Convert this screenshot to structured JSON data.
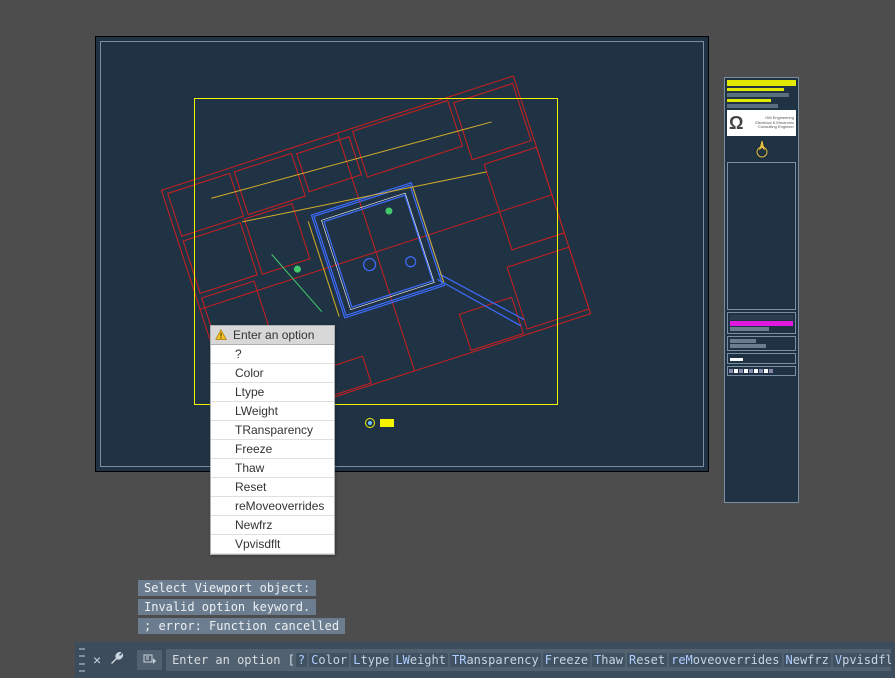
{
  "drawing": {
    "titleblock": {
      "logo_text": "Ω",
      "company_lines": [
        "OM Engineering",
        "Electrical & Electronic",
        "Consulting Engineer"
      ]
    }
  },
  "popup": {
    "header": "Enter an option",
    "items": [
      "?",
      "Color",
      "Ltype",
      "LWeight",
      "TRansparency",
      "Freeze",
      "Thaw",
      "Reset",
      "reMoveoverrides",
      "Newfrz",
      "Vpvisdflt"
    ]
  },
  "history": [
    "Select Viewport object:",
    "Invalid option keyword.",
    "; error: Function cancelled"
  ],
  "commandline": {
    "prompt": "Enter an option [",
    "suffix": "]:",
    "options": [
      {
        "hotkey": "?",
        "rest": ""
      },
      {
        "hotkey": "C",
        "rest": "olor"
      },
      {
        "hotkey": "L",
        "rest": "type"
      },
      {
        "hotkey": "LW",
        "rest": "eight"
      },
      {
        "hotkey": "TR",
        "rest": "ansparency"
      },
      {
        "hotkey": "F",
        "rest": "reeze"
      },
      {
        "hotkey": "T",
        "rest": "haw"
      },
      {
        "hotkey": "R",
        "rest": "eset"
      },
      {
        "hotkey": "reM",
        "rest": "oveoverrides"
      },
      {
        "hotkey": "N",
        "rest": "ewfrz"
      },
      {
        "hotkey": "V",
        "rest": "pvisdflt"
      }
    ]
  }
}
